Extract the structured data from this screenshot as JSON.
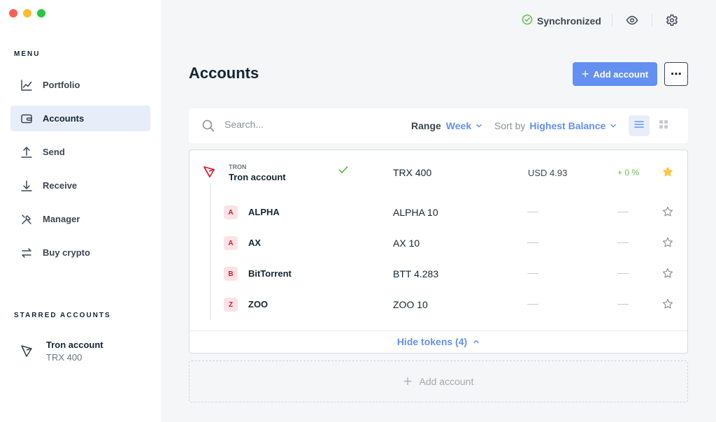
{
  "window": {
    "traffic_colors": [
      "#fc5f57",
      "#fdbc2e",
      "#28c840"
    ]
  },
  "sidebar": {
    "menu_label": "MENU",
    "items": [
      {
        "label": "Portfolio",
        "icon": "chart-line-icon"
      },
      {
        "label": "Accounts",
        "icon": "wallet-icon",
        "active": true
      },
      {
        "label": "Send",
        "icon": "arrow-up-icon"
      },
      {
        "label": "Receive",
        "icon": "arrow-down-icon"
      },
      {
        "label": "Manager",
        "icon": "tools-icon"
      },
      {
        "label": "Buy crypto",
        "icon": "exchange-icon"
      }
    ],
    "starred_label": "STARRED ACCOUNTS",
    "starred": [
      {
        "name": "Tron account",
        "balance": "TRX 400",
        "icon": "tron-icon"
      }
    ]
  },
  "topbar": {
    "sync_status": "Synchronized",
    "icons": [
      "check-circle-icon",
      "eye-icon",
      "gear-icon"
    ]
  },
  "main": {
    "title": "Accounts",
    "add_account_label": "Add account",
    "more_label": "⋯",
    "search_placeholder": "Search...",
    "range_label": "Range",
    "range_value": "Week",
    "sort_label": "Sort by",
    "sort_value": "Highest Balance",
    "account": {
      "ticker": "TRON",
      "name": "Tron account",
      "balance": "TRX 400",
      "fiat": "USD 4.93",
      "delta": "+ 0 %",
      "starred": true
    },
    "tokens": [
      {
        "badge": "A",
        "name": "ALPHA",
        "balance": "ALPHA 10"
      },
      {
        "badge": "A",
        "name": "AX",
        "balance": "AX 10"
      },
      {
        "badge": "B",
        "name": "BitTorrent",
        "balance": "BTT 4.283"
      },
      {
        "badge": "Z",
        "name": "ZOO",
        "balance": "ZOO 10"
      }
    ],
    "hide_tokens_label": "Hide tokens (4)",
    "add_account_placeholder": "Add account"
  },
  "colors": {
    "accent": "#6490f1",
    "positive": "#66be54",
    "tron_red": "#e0132a",
    "star": "#ffc53d"
  }
}
